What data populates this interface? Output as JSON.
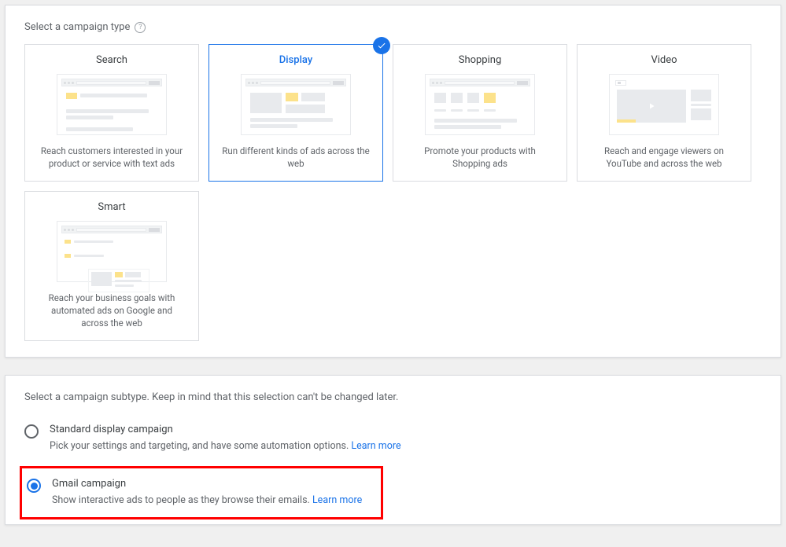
{
  "campaign_type": {
    "title": "Select a campaign type",
    "cards": [
      {
        "title": "Search",
        "desc": "Reach customers interested in your product or service with text ads"
      },
      {
        "title": "Display",
        "desc": "Run different kinds of ads across the web"
      },
      {
        "title": "Shopping",
        "desc": "Promote your products with Shopping ads"
      },
      {
        "title": "Video",
        "desc": "Reach and engage viewers on YouTube and across the web"
      },
      {
        "title": "Smart",
        "desc": "Reach your business goals with automated ads on Google and across the web"
      }
    ]
  },
  "subtype": {
    "instruction": "Select a campaign subtype. Keep in mind that this selection can't be changed later.",
    "options": [
      {
        "label": "Standard display campaign",
        "desc": "Pick your settings and targeting, and have some automation options. ",
        "learn": "Learn more"
      },
      {
        "label": "Gmail campaign",
        "desc": "Show interactive ads to people as they browse their emails. ",
        "learn": "Learn more"
      }
    ]
  }
}
